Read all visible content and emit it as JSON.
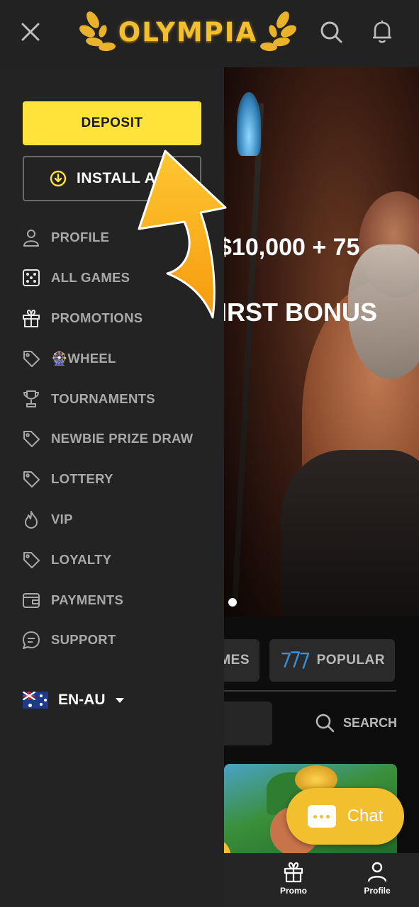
{
  "header": {
    "logo_text": "OLYMPIA",
    "close_icon": "close-icon",
    "search_icon": "search-icon",
    "bell_icon": "bell-icon"
  },
  "drawer": {
    "deposit_label": "DEPOSIT",
    "install_label": "INSTALL APP",
    "menu": [
      {
        "label": "PROFILE",
        "icon": "user-icon"
      },
      {
        "label": "ALL GAMES",
        "icon": "dice-icon"
      },
      {
        "label": "PROMOTIONS",
        "icon": "gift-icon"
      },
      {
        "label": "🎡WHEEL",
        "icon": "tag-icon"
      },
      {
        "label": "TOURNAMENTS",
        "icon": "trophy-icon"
      },
      {
        "label": "NEWBIE PRIZE DRAW",
        "icon": "tag-icon"
      },
      {
        "label": "LOTTERY",
        "icon": "tag-icon"
      },
      {
        "label": "VIP",
        "icon": "flame-icon"
      },
      {
        "label": "LOYALTY",
        "icon": "tag-icon"
      },
      {
        "label": "PAYMENTS",
        "icon": "wallet-icon"
      },
      {
        "label": "SUPPORT",
        "icon": "chat-bubble-icon"
      }
    ],
    "language": "EN-AU"
  },
  "banner": {
    "line1": "$10,000 + 75",
    "line2": "FIRST BONUS"
  },
  "categories": {
    "games_label": "GAMES",
    "popular_label": "POPULAR"
  },
  "search": {
    "label": "SEARCH"
  },
  "chat": {
    "label": "Chat"
  },
  "bottom_nav": {
    "promo_label": "Promo",
    "profile_label": "Profile"
  },
  "colors": {
    "accent_yellow": "#ffe23a",
    "chat_gold": "#f2bf2e",
    "drawer_bg": "#232323",
    "menu_text": "#a9a9a9"
  }
}
